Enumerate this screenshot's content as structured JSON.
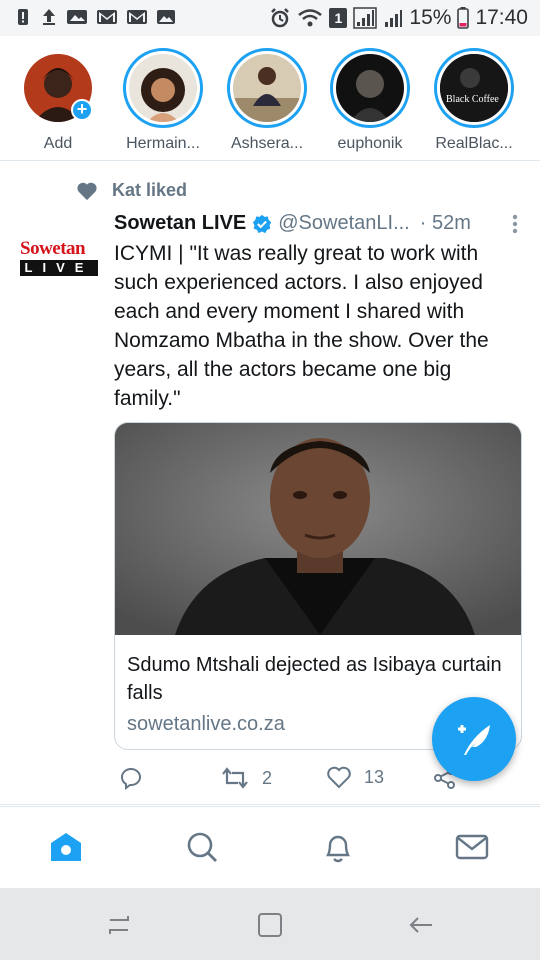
{
  "status_bar": {
    "battery": "15%",
    "time": "17:40",
    "sim_label": "1"
  },
  "stories": [
    {
      "name": "Add"
    },
    {
      "name": "Hermain..."
    },
    {
      "name": "Ashsera..."
    },
    {
      "name": "euphonik"
    },
    {
      "name": "RealBlac..."
    }
  ],
  "story_logo_text": "Black Coffee",
  "tweet": {
    "social_context": "Kat liked",
    "display_name": "Sowetan LIVE",
    "handle": "@SowetanLI...",
    "time": "· 52m",
    "avatar_logo_top": "Sowetan",
    "avatar_logo_bottom": "LIVE",
    "text": "ICYMI | \"It was really great to work with such experienced actors. I also enjoyed each and every moment I shared with Nomzamo Mbatha in the show. Over the years, all the actors became one big family.\"",
    "card_title": "Sdumo Mtshali dejected as Isibaya curtain falls",
    "card_domain": "sowetanlive.co.za",
    "retweets": "2",
    "likes": "13"
  },
  "colors": {
    "accent": "#1da1f2",
    "muted": "#657786"
  }
}
